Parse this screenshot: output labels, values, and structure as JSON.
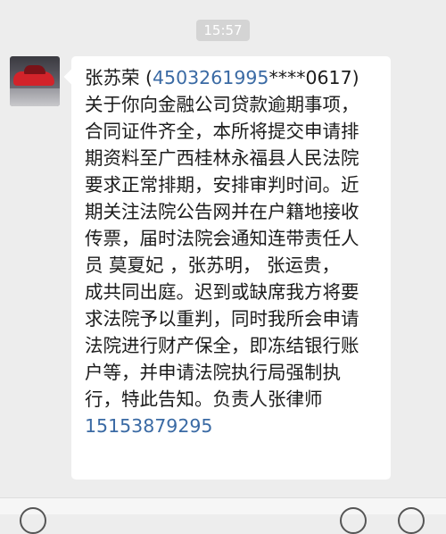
{
  "chat": {
    "timestamp": "15:57"
  },
  "message": {
    "sender_name": "张苏荣",
    "id_open": "  (",
    "id_number_prefix": "4503261995",
    "id_mask": "****",
    "id_number_suffix": "0617)",
    "body_lines": [
      "关于你向金融公司贷款逾期事项，",
      "合同证件齐全，本所将提交申请排",
      "期资料至广西桂林永福县人民法院",
      "要求正常排期，安排审判时间。近",
      "期关注法院公告网并在户籍地接收",
      "传票，届时法院会通知连带责任人",
      "员  莫夏妃 ，张苏明，  张运贵，",
      "成共同出庭。迟到或缺席我方将要",
      "求法院予以重判，同时我所会申请",
      "法院进行财产保全，即冻结银行账",
      "户等，并申请法院执行局强制执",
      "行，特此告知。负责人张律师"
    ],
    "phone": "15153879295"
  }
}
